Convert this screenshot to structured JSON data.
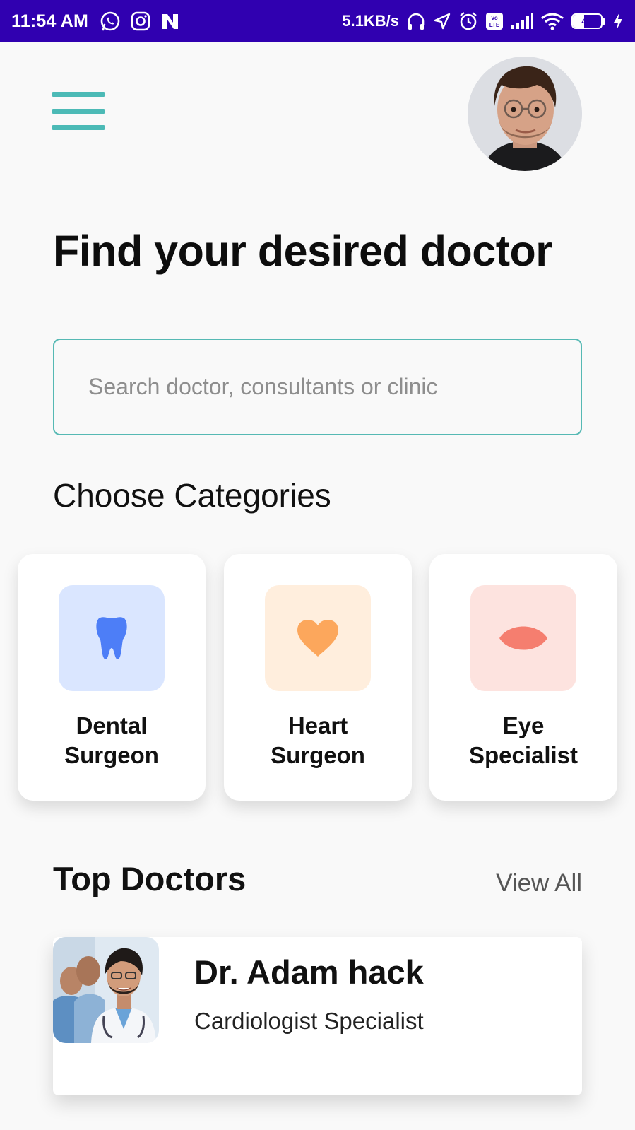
{
  "status_bar": {
    "time": "11:54 AM",
    "network_speed": "5.1KB/s",
    "battery_level": "41",
    "battery_fraction": 0.41,
    "icons": [
      "whatsapp-icon",
      "instagram-icon",
      "n-app-icon",
      "headphones-icon",
      "location-arrow-icon",
      "alarm-icon",
      "volte-icon",
      "signal-icon",
      "wifi-icon",
      "battery-icon",
      "charging-icon"
    ]
  },
  "header": {
    "menu_icon": "hamburger-menu-icon",
    "avatar": "user-avatar"
  },
  "main": {
    "title": "Find your desired doctor",
    "search": {
      "placeholder": "Search doctor, consultants or clinic",
      "value": ""
    },
    "categories_title": "Choose Categories",
    "categories": [
      {
        "label": "Dental\nSurgeon",
        "icon": "tooth-icon",
        "bg_color": "#dae6ff",
        "icon_color": "#4d7ef7"
      },
      {
        "label": "Heart\nSurgeon",
        "icon": "heart-icon",
        "bg_color": "#ffeedd",
        "icon_color": "#fca75c"
      },
      {
        "label": "Eye\nSpecialist",
        "icon": "eye-icon",
        "bg_color": "#fde3df",
        "icon_color": "#f57e6f"
      }
    ],
    "top_doctors_title": "Top Doctors",
    "view_all_label": "View All",
    "doctors": [
      {
        "name": "Dr. Adam hack",
        "specialty": "Cardiologist Specialist"
      }
    ]
  },
  "colors": {
    "status_bar": "#3000b0",
    "accent": "#4cbab6",
    "background": "#f9f9f9"
  }
}
